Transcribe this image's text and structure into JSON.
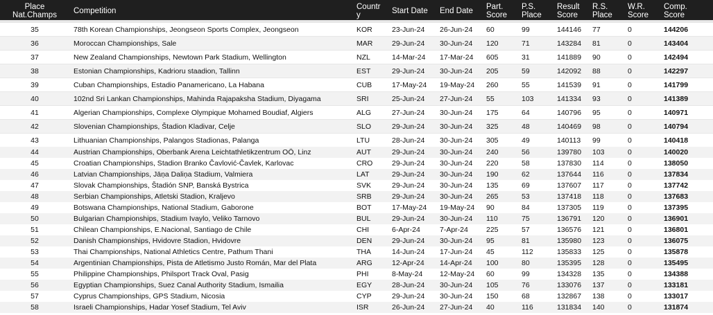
{
  "headers": {
    "place": "Place\nNat.Champs",
    "competition": "Competition",
    "country": "Countr\ny",
    "start_date": "Start Date",
    "end_date": "End Date",
    "part_score": "Part.\nScore",
    "ps_place": "P.S.\nPlace",
    "result_score": "Result\nScore",
    "rs_place": "R.S.\nPlace",
    "wr_score": "W.R.\nScore",
    "comp_score": "Comp.\nScore"
  },
  "rows": [
    {
      "place": "35",
      "competition": "78th Korean Championships, Jeongseon Sports Complex, Jeongseon",
      "country": "KOR",
      "start": "23-Jun-24",
      "end": "26-Jun-24",
      "part": "60",
      "ps": "99",
      "result": "144146",
      "rs": "77",
      "wr": "0",
      "comp": "144206"
    },
    {
      "place": "36",
      "competition": "Moroccan Championships, Sale",
      "country": "MAR",
      "start": "29-Jun-24",
      "end": "30-Jun-24",
      "part": "120",
      "ps": "71",
      "result": "143284",
      "rs": "81",
      "wr": "0",
      "comp": "143404"
    },
    {
      "place": "37",
      "competition": "New Zealand Championships, Newtown Park Stadium, Wellington",
      "country": "NZL",
      "start": "14-Mar-24",
      "end": "17-Mar-24",
      "part": "605",
      "ps": "31",
      "result": "141889",
      "rs": "90",
      "wr": "0",
      "comp": "142494"
    },
    {
      "place": "38",
      "competition": "Estonian Championships, Kadrioru staadion, Tallinn",
      "country": "EST",
      "start": "29-Jun-24",
      "end": "30-Jun-24",
      "part": "205",
      "ps": "59",
      "result": "142092",
      "rs": "88",
      "wr": "0",
      "comp": "142297"
    },
    {
      "place": "39",
      "competition": "Cuban Championships, Estadio Panamericano, La Habana",
      "country": "CUB",
      "start": "17-May-24",
      "end": "19-May-24",
      "part": "260",
      "ps": "55",
      "result": "141539",
      "rs": "91",
      "wr": "0",
      "comp": "141799"
    },
    {
      "place": "40",
      "competition": "102nd Sri Lankan Championships, Mahinda Rajapaksha Stadium, Diyagama",
      "country": "SRI",
      "start": "25-Jun-24",
      "end": "27-Jun-24",
      "part": "55",
      "ps": "103",
      "result": "141334",
      "rs": "93",
      "wr": "0",
      "comp": "141389"
    },
    {
      "place": "41",
      "competition": "Algerian Championships, Complexe Olympique Mohamed Boudiaf, Algiers",
      "country": "ALG",
      "start": "27-Jun-24",
      "end": "30-Jun-24",
      "part": "175",
      "ps": "64",
      "result": "140796",
      "rs": "95",
      "wr": "0",
      "comp": "140971"
    },
    {
      "place": "42",
      "competition": "Slovenian Championships, Štadion Kladivar, Celje",
      "country": "SLO",
      "start": "29-Jun-24",
      "end": "30-Jun-24",
      "part": "325",
      "ps": "48",
      "result": "140469",
      "rs": "98",
      "wr": "0",
      "comp": "140794"
    },
    {
      "place": "43",
      "competition": "Lithuanian Championships, Palangos Stadionas, Palanga",
      "country": "LTU",
      "start": "28-Jun-24",
      "end": "30-Jun-24",
      "part": "305",
      "ps": "49",
      "result": "140113",
      "rs": "99",
      "wr": "0",
      "comp": "140418"
    },
    {
      "place": "44",
      "competition": "Austrian Championships, Oberbank Arena Leichtathletikzentrum OÖ, Linz",
      "country": "AUT",
      "start": "29-Jun-24",
      "end": "30-Jun-24",
      "part": "240",
      "ps": "56",
      "result": "139780",
      "rs": "103",
      "wr": "0",
      "comp": "140020"
    },
    {
      "place": "45",
      "competition": "Croatian Championships, Stadion Branko Čavlović-Čavlek, Karlovac",
      "country": "CRO",
      "start": "29-Jun-24",
      "end": "30-Jun-24",
      "part": "220",
      "ps": "58",
      "result": "137830",
      "rs": "114",
      "wr": "0",
      "comp": "138050"
    },
    {
      "place": "46",
      "competition": "Latvian Championships, Jāņa Daliņa Stadium, Valmiera",
      "country": "LAT",
      "start": "29-Jun-24",
      "end": "30-Jun-24",
      "part": "190",
      "ps": "62",
      "result": "137644",
      "rs": "116",
      "wr": "0",
      "comp": "137834"
    },
    {
      "place": "47",
      "competition": "Slovak Championships, Štadión SNP, Banská Bystrica",
      "country": "SVK",
      "start": "29-Jun-24",
      "end": "30-Jun-24",
      "part": "135",
      "ps": "69",
      "result": "137607",
      "rs": "117",
      "wr": "0",
      "comp": "137742"
    },
    {
      "place": "48",
      "competition": "Serbian Championships, Atletski Stadion, Kraljevo",
      "country": "SRB",
      "start": "29-Jun-24",
      "end": "30-Jun-24",
      "part": "265",
      "ps": "53",
      "result": "137418",
      "rs": "118",
      "wr": "0",
      "comp": "137683"
    },
    {
      "place": "49",
      "competition": "Botswana Championships, National Stadium, Gaborone",
      "country": "BOT",
      "start": "17-May-24",
      "end": "19-May-24",
      "part": "90",
      "ps": "84",
      "result": "137305",
      "rs": "119",
      "wr": "0",
      "comp": "137395"
    },
    {
      "place": "50",
      "competition": "Bulgarian Championships, Stadium Ivaylo, Veliko Tarnovo",
      "country": "BUL",
      "start": "29-Jun-24",
      "end": "30-Jun-24",
      "part": "110",
      "ps": "75",
      "result": "136791",
      "rs": "120",
      "wr": "0",
      "comp": "136901"
    },
    {
      "place": "51",
      "competition": "Chilean Championships, E.Nacional, Santiago de Chile",
      "country": "CHI",
      "start": "6-Apr-24",
      "end": "7-Apr-24",
      "part": "225",
      "ps": "57",
      "result": "136576",
      "rs": "121",
      "wr": "0",
      "comp": "136801"
    },
    {
      "place": "52",
      "competition": "Danish Championships, Hvidovre Stadion, Hvidovre",
      "country": "DEN",
      "start": "29-Jun-24",
      "end": "30-Jun-24",
      "part": "95",
      "ps": "81",
      "result": "135980",
      "rs": "123",
      "wr": "0",
      "comp": "136075"
    },
    {
      "place": "53",
      "competition": "Thai Championships, National Athletics Centre, Pathum Thani",
      "country": "THA",
      "start": "14-Jun-24",
      "end": "17-Jun-24",
      "part": "45",
      "ps": "112",
      "result": "135833",
      "rs": "125",
      "wr": "0",
      "comp": "135878"
    },
    {
      "place": "54",
      "competition": "Argentinian Championships, Pista de Atletismo Justo Román, Mar del Plata",
      "country": "ARG",
      "start": "12-Apr-24",
      "end": "14-Apr-24",
      "part": "100",
      "ps": "80",
      "result": "135395",
      "rs": "128",
      "wr": "0",
      "comp": "135495"
    },
    {
      "place": "55",
      "competition": "Philippine Championships, Philsport Track Oval, Pasig",
      "country": "PHI",
      "start": "8-May-24",
      "end": "12-May-24",
      "part": "60",
      "ps": "99",
      "result": "134328",
      "rs": "135",
      "wr": "0",
      "comp": "134388"
    },
    {
      "place": "56",
      "competition": "Egyptian Championships, Suez Canal Authority Stadium, Ismailia",
      "country": "EGY",
      "start": "28-Jun-24",
      "end": "30-Jun-24",
      "part": "105",
      "ps": "76",
      "result": "133076",
      "rs": "137",
      "wr": "0",
      "comp": "133181"
    },
    {
      "place": "57",
      "competition": "Cyprus Championships, GPS Stadium, Nicosia",
      "country": "CYP",
      "start": "29-Jun-24",
      "end": "30-Jun-24",
      "part": "150",
      "ps": "68",
      "result": "132867",
      "rs": "138",
      "wr": "0",
      "comp": "133017"
    },
    {
      "place": "58",
      "competition": "Israeli Championships, Hadar Yosef Stadium, Tel Aviv",
      "country": "ISR",
      "start": "26-Jun-24",
      "end": "27-Jun-24",
      "part": "40",
      "ps": "116",
      "result": "131834",
      "rs": "140",
      "wr": "0",
      "comp": "131874"
    }
  ]
}
